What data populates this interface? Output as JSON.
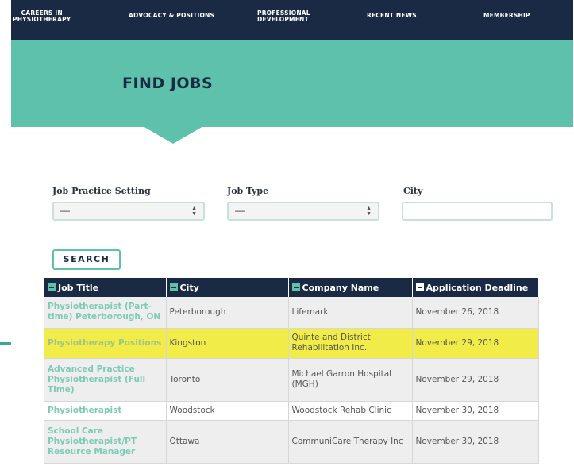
{
  "nav": [
    {
      "lines": [
        "Careers in",
        "Physiotherapy"
      ]
    },
    {
      "lines": [
        "Advocacy & Positions"
      ]
    },
    {
      "lines": [
        "Professional",
        "Development"
      ]
    },
    {
      "lines": [
        "Recent News"
      ]
    },
    {
      "lines": [
        "Membership"
      ]
    }
  ],
  "hero": {
    "title": "FIND JOBS"
  },
  "filters": {
    "practice_label": "Job Practice Setting",
    "practice_value": "—",
    "type_label": "Job Type",
    "type_value": "—",
    "city_label": "City",
    "city_value": ""
  },
  "search_label": "SEARCH",
  "table": {
    "headers": [
      "Job Title",
      "City",
      "Company Name",
      "Application Deadline"
    ],
    "rows": [
      {
        "title": "Physiotherapist (Part-time) Peterborough, ON",
        "city": "Peterborough",
        "company": "Lifemark",
        "deadline": "November 26, 2018",
        "highlighted": false
      },
      {
        "title": "Physiotherapy Positions",
        "city": "Kingston",
        "company": "Quinte and District Rehabilitation Inc.",
        "deadline": "November 29, 2018",
        "highlighted": true
      },
      {
        "title": "Advanced Practice Physiotherapist (Full Time)",
        "city": "Toronto",
        "company": "Michael Garron Hospital (MGH)",
        "deadline": "November 29, 2018",
        "highlighted": false
      },
      {
        "title": "Physiotherapist",
        "city": "Woodstock",
        "company": "Woodstock Rehab Clinic",
        "deadline": "November 30, 2018",
        "highlighted": false
      },
      {
        "title": "School Care Physiotherapist/PT Resource Manager",
        "city": "Ottawa",
        "company": "CommuniCare Therapy Inc",
        "deadline": "November 30, 2018",
        "highlighted": false
      }
    ]
  },
  "colors": {
    "navy": "#1b2a44",
    "teal": "#5ec1ab",
    "highlight": "#f2ec48"
  }
}
